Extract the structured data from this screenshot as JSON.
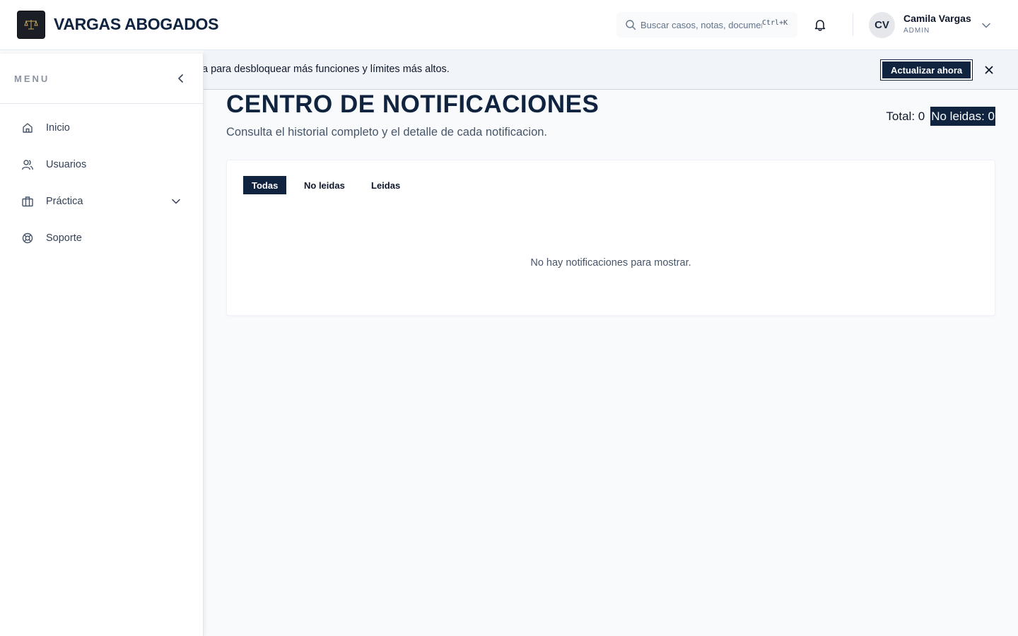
{
  "header": {
    "brand": "VARGAS ABOGADOS",
    "search": {
      "placeholder": "Buscar casos, notas, documentos",
      "shortcut": "Ctrl+K"
    },
    "user": {
      "initials": "CV",
      "name": "Camila Vargas",
      "role": "ADMIN"
    }
  },
  "sidebar": {
    "title": "MENU",
    "items": [
      {
        "label": "Inicio",
        "icon": "home-icon"
      },
      {
        "label": "Usuarios",
        "icon": "users-icon"
      },
      {
        "label": "Práctica",
        "icon": "briefcase-icon"
      },
      {
        "label": "Soporte",
        "icon": "lifebuoy-icon"
      }
    ]
  },
  "banner": {
    "text": "a para desbloquear más funciones y límites más altos.",
    "cta_label": "Actualizar ahora"
  },
  "main": {
    "title": "CENTRO DE NOTIFICACIONES",
    "subtitle": "Consulta el historial completo y el detalle de cada notificacion.",
    "total_label": "Total: 0",
    "unread_label": "No leidas: 0",
    "tabs": [
      {
        "label": "Todas",
        "active": true
      },
      {
        "label": "No leidas",
        "active": false
      },
      {
        "label": "Leidas",
        "active": false
      }
    ],
    "empty_message": "No hay notificaciones para mostrar."
  },
  "colors": {
    "primary": "#10233f",
    "background": "#f8fafc",
    "banner": "#f1f5f9"
  }
}
